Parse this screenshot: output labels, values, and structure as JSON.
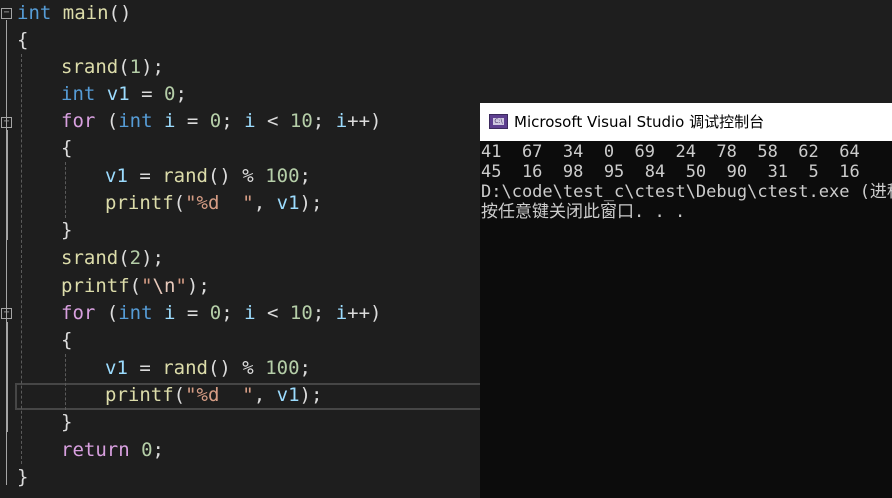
{
  "editor": {
    "lines": [
      [
        {
          "t": "int",
          "c": "kw"
        },
        {
          "t": " ",
          "c": "plain"
        },
        {
          "t": "main",
          "c": "fn"
        },
        {
          "t": "()",
          "c": "plain"
        }
      ],
      [
        {
          "t": "{",
          "c": "plain"
        }
      ],
      [
        {
          "t": "srand",
          "c": "fn"
        },
        {
          "t": "(",
          "c": "plain"
        },
        {
          "t": "1",
          "c": "num"
        },
        {
          "t": ");",
          "c": "plain"
        }
      ],
      [
        {
          "t": "int",
          "c": "kw"
        },
        {
          "t": " ",
          "c": "plain"
        },
        {
          "t": "v1",
          "c": "var"
        },
        {
          "t": " = ",
          "c": "plain"
        },
        {
          "t": "0",
          "c": "num"
        },
        {
          "t": ";",
          "c": "plain"
        }
      ],
      [
        {
          "t": "for",
          "c": "ctl"
        },
        {
          "t": " (",
          "c": "plain"
        },
        {
          "t": "int",
          "c": "kw"
        },
        {
          "t": " ",
          "c": "plain"
        },
        {
          "t": "i",
          "c": "var"
        },
        {
          "t": " = ",
          "c": "plain"
        },
        {
          "t": "0",
          "c": "num"
        },
        {
          "t": "; ",
          "c": "plain"
        },
        {
          "t": "i",
          "c": "var"
        },
        {
          "t": " < ",
          "c": "plain"
        },
        {
          "t": "10",
          "c": "num"
        },
        {
          "t": "; ",
          "c": "plain"
        },
        {
          "t": "i",
          "c": "var"
        },
        {
          "t": "++)",
          "c": "plain"
        }
      ],
      [
        {
          "t": "{",
          "c": "plain"
        }
      ],
      [
        {
          "t": "v1",
          "c": "var"
        },
        {
          "t": " = ",
          "c": "plain"
        },
        {
          "t": "rand",
          "c": "fn"
        },
        {
          "t": "() % ",
          "c": "plain"
        },
        {
          "t": "100",
          "c": "num"
        },
        {
          "t": ";",
          "c": "plain"
        }
      ],
      [
        {
          "t": "printf",
          "c": "fn"
        },
        {
          "t": "(",
          "c": "plain"
        },
        {
          "t": "\"%d  \"",
          "c": "str"
        },
        {
          "t": ", ",
          "c": "plain"
        },
        {
          "t": "v1",
          "c": "var"
        },
        {
          "t": ");",
          "c": "plain"
        }
      ],
      [
        {
          "t": "}",
          "c": "plain"
        }
      ],
      [
        {
          "t": "srand",
          "c": "fn"
        },
        {
          "t": "(",
          "c": "plain"
        },
        {
          "t": "2",
          "c": "num"
        },
        {
          "t": ");",
          "c": "plain"
        }
      ],
      [
        {
          "t": "printf",
          "c": "fn"
        },
        {
          "t": "(",
          "c": "plain"
        },
        {
          "t": "\"",
          "c": "str"
        },
        {
          "t": "\\n",
          "c": "esc"
        },
        {
          "t": "\"",
          "c": "str"
        },
        {
          "t": ");",
          "c": "plain"
        }
      ],
      [
        {
          "t": "for",
          "c": "ctl"
        },
        {
          "t": " (",
          "c": "plain"
        },
        {
          "t": "int",
          "c": "kw"
        },
        {
          "t": " ",
          "c": "plain"
        },
        {
          "t": "i",
          "c": "var"
        },
        {
          "t": " = ",
          "c": "plain"
        },
        {
          "t": "0",
          "c": "num"
        },
        {
          "t": "; ",
          "c": "plain"
        },
        {
          "t": "i",
          "c": "var"
        },
        {
          "t": " < ",
          "c": "plain"
        },
        {
          "t": "10",
          "c": "num"
        },
        {
          "t": "; ",
          "c": "plain"
        },
        {
          "t": "i",
          "c": "var"
        },
        {
          "t": "++)",
          "c": "plain"
        }
      ],
      [
        {
          "t": "{",
          "c": "plain"
        }
      ],
      [
        {
          "t": "v1",
          "c": "var"
        },
        {
          "t": " = ",
          "c": "plain"
        },
        {
          "t": "rand",
          "c": "fn"
        },
        {
          "t": "() % ",
          "c": "plain"
        },
        {
          "t": "100",
          "c": "num"
        },
        {
          "t": ";",
          "c": "plain"
        }
      ],
      [
        {
          "t": "printf",
          "c": "fn"
        },
        {
          "t": "(",
          "c": "plain"
        },
        {
          "t": "\"%d  \"",
          "c": "str"
        },
        {
          "t": ", ",
          "c": "plain"
        },
        {
          "t": "v1",
          "c": "var"
        },
        {
          "t": ");",
          "c": "plain"
        }
      ],
      [
        {
          "t": "}",
          "c": "plain"
        }
      ],
      [
        {
          "t": "return",
          "c": "ctl"
        },
        {
          "t": " ",
          "c": "plain"
        },
        {
          "t": "0",
          "c": "num"
        },
        {
          "t": ";",
          "c": "plain"
        }
      ],
      [
        {
          "t": "}",
          "c": "plain"
        }
      ]
    ],
    "colors": {
      "background": "#1e1e1e",
      "keyword": "#569cd6",
      "control": "#d8a0df",
      "function": "#dcdcaa",
      "variable": "#9cdcfe",
      "number": "#b5cea8",
      "string": "#d69d85",
      "text": "#dcdcdc"
    }
  },
  "console": {
    "title": "Microsoft Visual Studio 调试控制台",
    "icon": "console-app-icon",
    "lines": [
      "41  67  34  0  69  24  78  58  62  64",
      "45  16  98  95  84  50  90  31  5  16",
      "D:\\code\\test_c\\ctest\\Debug\\ctest.exe (进程",
      "按任意键关闭此窗口. . ."
    ]
  }
}
